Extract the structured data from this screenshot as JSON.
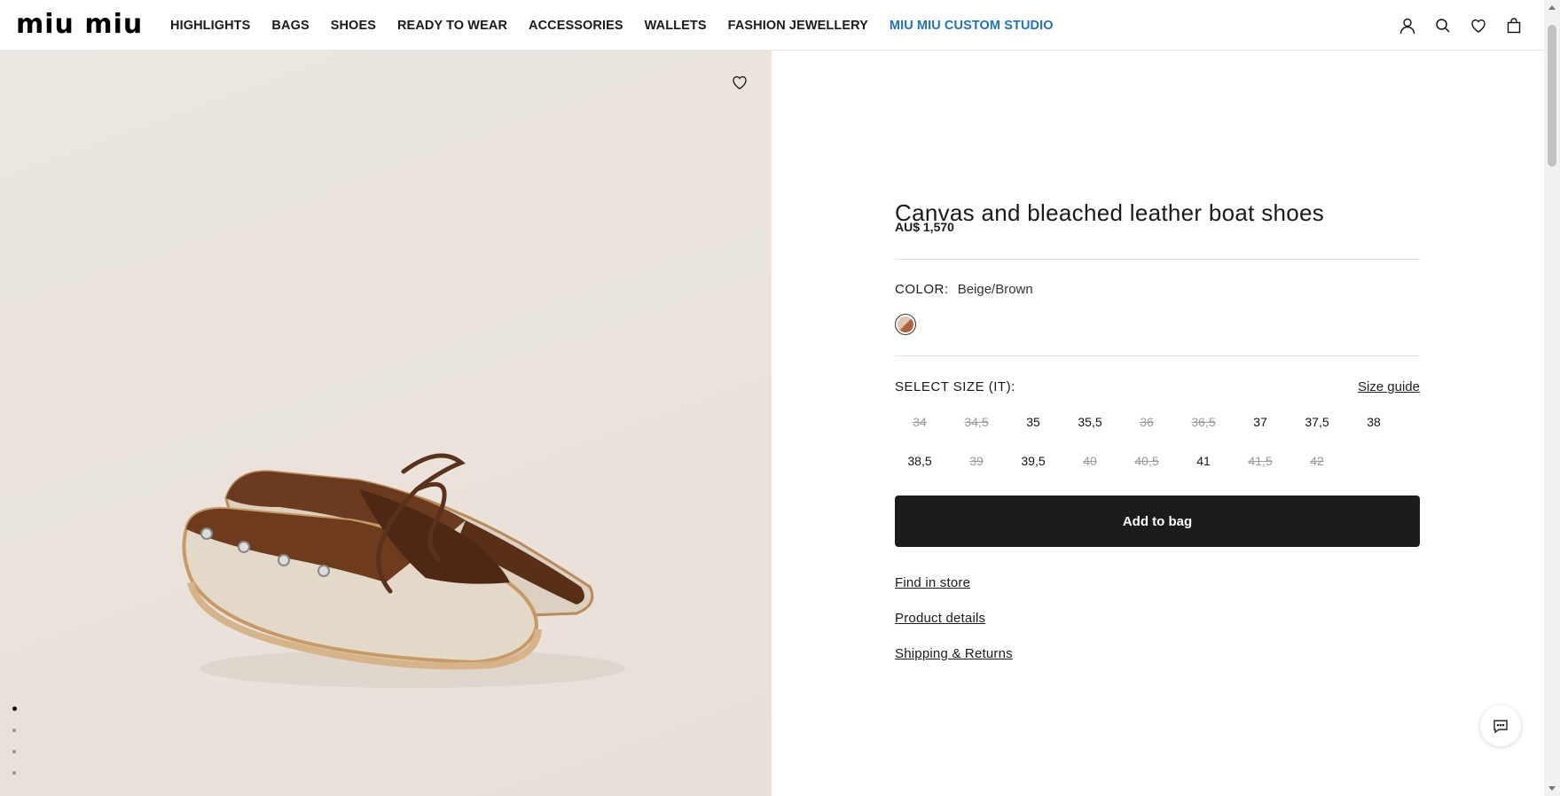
{
  "brand": {
    "logo": "miu miu"
  },
  "nav": {
    "items": [
      "HIGHLIGHTS",
      "BAGS",
      "SHOES",
      "READY TO WEAR",
      "ACCESSORIES",
      "WALLETS",
      "FASHION JEWELLERY"
    ],
    "accent_item": "MIU MIU CUSTOM STUDIO",
    "accent_color": "#1f73b7"
  },
  "header_icons": [
    "account-icon",
    "search-icon",
    "wishlist-icon",
    "bag-icon"
  ],
  "gallery": {
    "image_count": 4,
    "active_index": 0
  },
  "product": {
    "title": "Canvas and bleached leather boat shoes",
    "price": "AU$ 1,570",
    "color_label": "COLOR:",
    "color_value": "Beige/Brown",
    "size_label": "SELECT SIZE (IT):",
    "size_guide": "Size guide",
    "sizes": [
      {
        "label": "34",
        "available": false
      },
      {
        "label": "34,5",
        "available": false
      },
      {
        "label": "35",
        "available": true
      },
      {
        "label": "35,5",
        "available": true
      },
      {
        "label": "36",
        "available": false
      },
      {
        "label": "36,5",
        "available": false
      },
      {
        "label": "37",
        "available": true
      },
      {
        "label": "37,5",
        "available": true
      },
      {
        "label": "38",
        "available": true
      },
      {
        "label": "38,5",
        "available": true
      },
      {
        "label": "39",
        "available": false
      },
      {
        "label": "39,5",
        "available": true
      },
      {
        "label": "40",
        "available": false
      },
      {
        "label": "40,5",
        "available": false
      },
      {
        "label": "41",
        "available": true
      },
      {
        "label": "41,5",
        "available": false
      },
      {
        "label": "42",
        "available": false
      }
    ],
    "add_to_bag": "Add to bag",
    "links": [
      "Find in store",
      "Product details",
      "Shipping & Returns"
    ]
  },
  "colors": {
    "button": "#1b1c1e",
    "background_image": "#e9e3db"
  }
}
